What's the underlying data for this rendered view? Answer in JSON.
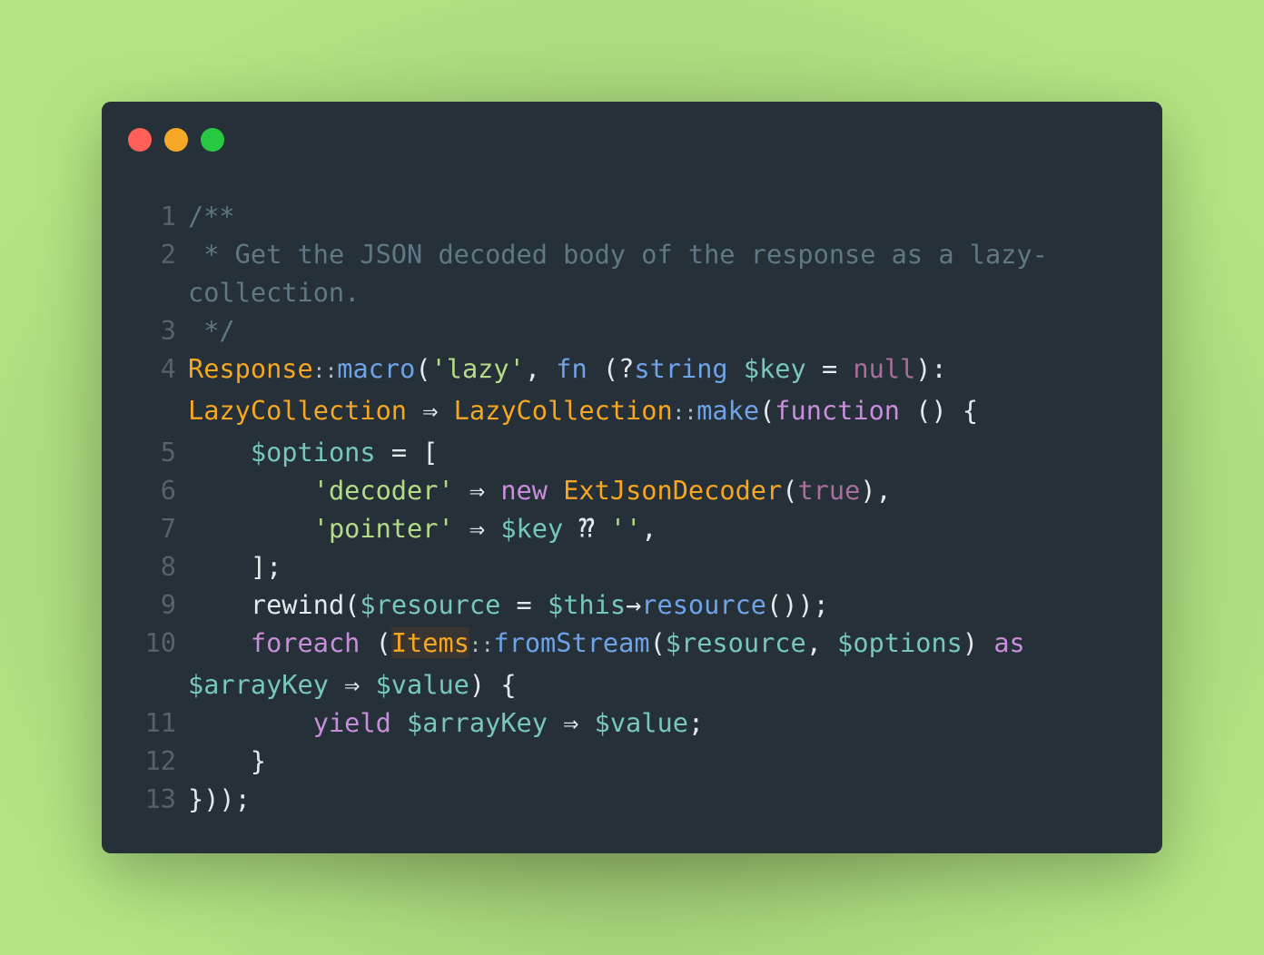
{
  "window": {
    "controls": [
      {
        "name": "close",
        "color": "#fe5f57"
      },
      {
        "name": "minimize",
        "color": "#f7a826"
      },
      {
        "name": "maximize",
        "color": "#28c940"
      }
    ]
  },
  "code": {
    "language": "php",
    "lines": [
      {
        "n": "1",
        "rows": [
          [
            [
              "comment",
              "/**"
            ]
          ]
        ]
      },
      {
        "n": "2",
        "rows": [
          [
            [
              "comment",
              " * Get the JSON decoded body of the response as a lazy-"
            ]
          ],
          [
            [
              "comment",
              "collection."
            ]
          ]
        ]
      },
      {
        "n": "3",
        "rows": [
          [
            [
              "comment",
              " */"
            ]
          ]
        ]
      },
      {
        "n": "4",
        "rows": [
          [
            [
              "class",
              "Response"
            ],
            [
              "sep",
              "::"
            ],
            [
              "func",
              "macro"
            ],
            [
              "punct",
              "("
            ],
            [
              "str",
              "'lazy'"
            ],
            [
              "punct",
              ", "
            ],
            [
              "func",
              "fn"
            ],
            [
              "punct",
              " (?"
            ],
            [
              "func",
              "string"
            ],
            [
              "punct",
              " "
            ],
            [
              "var",
              "$key"
            ],
            [
              "op",
              " = "
            ],
            [
              "const",
              "null"
            ],
            [
              "punct",
              "):"
            ]
          ],
          [
            [
              "class",
              "LazyCollection"
            ],
            [
              "op",
              " ⇒ "
            ],
            [
              "class",
              "LazyCollection"
            ],
            [
              "sep",
              "::"
            ],
            [
              "func",
              "make"
            ],
            [
              "punct",
              "("
            ],
            [
              "kw",
              "function"
            ],
            [
              "punct",
              " () {"
            ]
          ]
        ]
      },
      {
        "n": "5",
        "rows": [
          [
            [
              "punct",
              "    "
            ],
            [
              "var",
              "$options"
            ],
            [
              "op",
              " = "
            ],
            [
              "punct",
              "["
            ]
          ]
        ]
      },
      {
        "n": "6",
        "rows": [
          [
            [
              "punct",
              "        "
            ],
            [
              "str",
              "'decoder'"
            ],
            [
              "op",
              " ⇒ "
            ],
            [
              "kw",
              "new"
            ],
            [
              "punct",
              " "
            ],
            [
              "class",
              "ExtJsonDecoder"
            ],
            [
              "punct",
              "("
            ],
            [
              "const",
              "true"
            ],
            [
              "punct",
              "),"
            ]
          ]
        ]
      },
      {
        "n": "7",
        "rows": [
          [
            [
              "punct",
              "        "
            ],
            [
              "str",
              "'pointer'"
            ],
            [
              "op",
              " ⇒ "
            ],
            [
              "var",
              "$key"
            ],
            [
              "op",
              " ⁇ "
            ],
            [
              "str",
              "''"
            ],
            [
              "punct",
              ","
            ]
          ]
        ]
      },
      {
        "n": "8",
        "rows": [
          [
            [
              "punct",
              "    ];"
            ]
          ]
        ]
      },
      {
        "n": "9",
        "rows": [
          [
            [
              "punct",
              "    rewind("
            ],
            [
              "var",
              "$resource"
            ],
            [
              "op",
              " = "
            ],
            [
              "var",
              "$this"
            ],
            [
              "op",
              "→"
            ],
            [
              "func",
              "resource"
            ],
            [
              "punct",
              "());"
            ]
          ]
        ]
      },
      {
        "n": "10",
        "rows": [
          [
            [
              "punct",
              "    "
            ],
            [
              "kw",
              "foreach"
            ],
            [
              "punct",
              " ("
            ],
            [
              "class hl",
              "Items"
            ],
            [
              "sep",
              "::"
            ],
            [
              "func",
              "fromStream"
            ],
            [
              "punct",
              "("
            ],
            [
              "var",
              "$resource"
            ],
            [
              "punct",
              ", "
            ],
            [
              "var",
              "$options"
            ],
            [
              "punct",
              ") "
            ],
            [
              "kw",
              "as"
            ]
          ],
          [
            [
              "var",
              "$arrayKey"
            ],
            [
              "op",
              " ⇒ "
            ],
            [
              "var",
              "$value"
            ],
            [
              "punct",
              ") {"
            ]
          ]
        ]
      },
      {
        "n": "11",
        "rows": [
          [
            [
              "punct",
              "        "
            ],
            [
              "kw",
              "yield"
            ],
            [
              "punct",
              " "
            ],
            [
              "var",
              "$arrayKey"
            ],
            [
              "op",
              " ⇒ "
            ],
            [
              "var",
              "$value"
            ],
            [
              "punct",
              ";"
            ]
          ]
        ]
      },
      {
        "n": "12",
        "rows": [
          [
            [
              "punct",
              "    }"
            ]
          ]
        ]
      },
      {
        "n": "13",
        "rows": [
          [
            [
              "punct",
              "}));"
            ]
          ]
        ]
      }
    ]
  }
}
